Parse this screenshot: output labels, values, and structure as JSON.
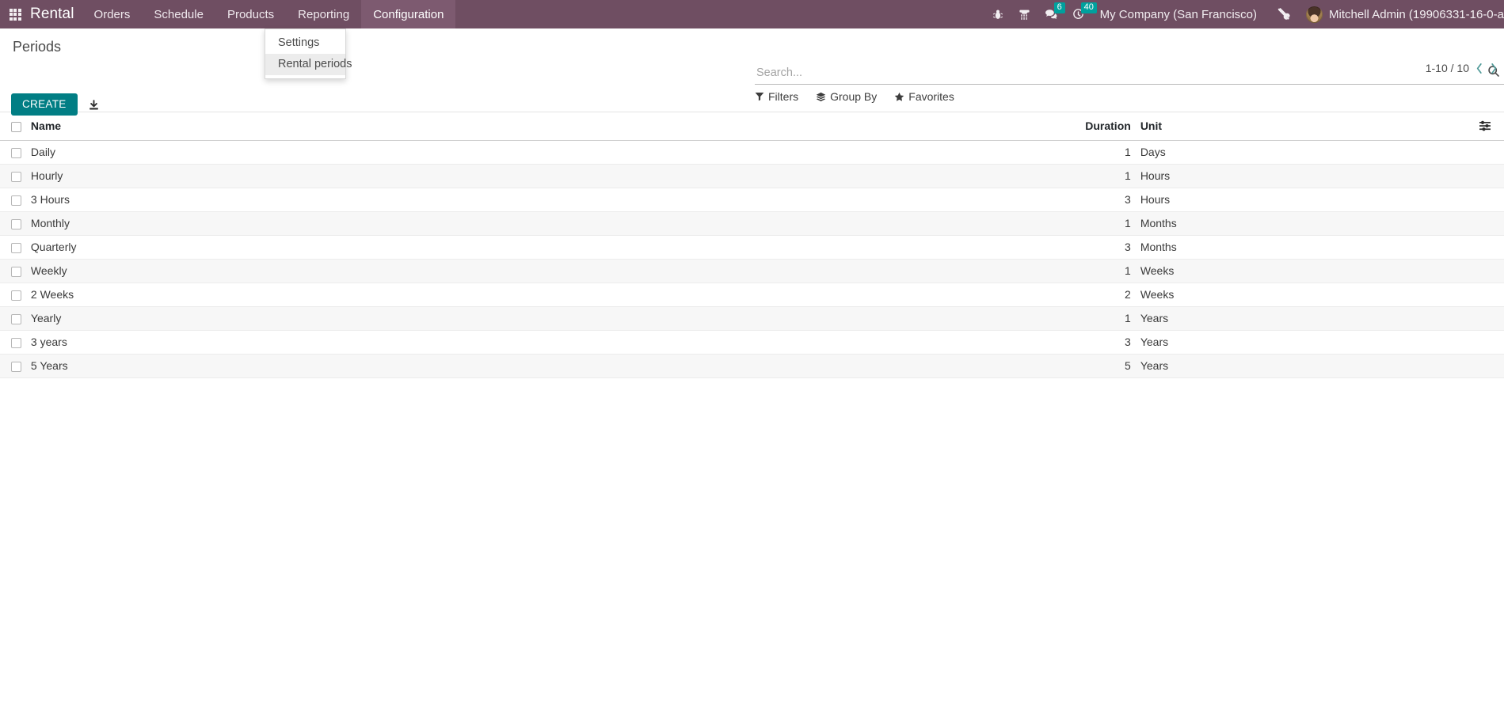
{
  "navbar": {
    "apps_icon": "apps-grid-icon",
    "brand": "Rental",
    "menu_items": [
      {
        "label": "Orders",
        "active": false
      },
      {
        "label": "Schedule",
        "active": false
      },
      {
        "label": "Products",
        "active": false
      },
      {
        "label": "Reporting",
        "active": false
      },
      {
        "label": "Configuration",
        "active": true
      }
    ],
    "systray": {
      "bug_icon": "bug-icon",
      "voip_icon": "phone-keypad-icon",
      "messages_icon": "messages-icon",
      "messages_count": "6",
      "activities_icon": "clock-activities-icon",
      "activities_count": "40"
    },
    "company": "My Company (San Francisco)",
    "tools_icon": "tools-wrench-icon",
    "user_name": "Mitchell Admin (19906331-16-0-a",
    "avatar": "user-avatar"
  },
  "dropdown": {
    "items": [
      {
        "label": "Settings",
        "highlighted": false
      },
      {
        "label": "Rental periods",
        "highlighted": true
      }
    ]
  },
  "control_panel": {
    "title": "Periods",
    "create_label": "CREATE",
    "export_icon": "download-export-icon",
    "search": {
      "placeholder": "Search...",
      "value": "",
      "search_icon": "search-icon"
    },
    "filters": [
      {
        "label": "Filters",
        "icon": "filter-funnel-icon"
      },
      {
        "label": "Group By",
        "icon": "layers-group-icon"
      },
      {
        "label": "Favorites",
        "icon": "star-favorites-icon"
      }
    ],
    "pager": {
      "range": "1-10 / 10",
      "prev_icon": "chevron-left-icon",
      "next_icon": "chevron-right-icon"
    }
  },
  "list": {
    "columns": [
      "Name",
      "Duration",
      "Unit"
    ],
    "options_icon": "column-options-icon",
    "rows": [
      {
        "name": "Daily",
        "duration": "1",
        "unit": "Days"
      },
      {
        "name": "Hourly",
        "duration": "1",
        "unit": "Hours"
      },
      {
        "name": "3 Hours",
        "duration": "3",
        "unit": "Hours"
      },
      {
        "name": "Monthly",
        "duration": "1",
        "unit": "Months"
      },
      {
        "name": "Quarterly",
        "duration": "3",
        "unit": "Months"
      },
      {
        "name": "Weekly",
        "duration": "1",
        "unit": "Weeks"
      },
      {
        "name": "2 Weeks",
        "duration": "2",
        "unit": "Weeks"
      },
      {
        "name": "Yearly",
        "duration": "1",
        "unit": "Years"
      },
      {
        "name": "3 years",
        "duration": "3",
        "unit": "Years"
      },
      {
        "name": "5 Years",
        "duration": "5",
        "unit": "Years"
      }
    ]
  },
  "colors": {
    "navbar_bg": "#6f4e62",
    "navbar_active": "#7d5a70",
    "primary": "#017e84",
    "badge": "#00a09d",
    "pager_arrow": "#4f9a98"
  }
}
